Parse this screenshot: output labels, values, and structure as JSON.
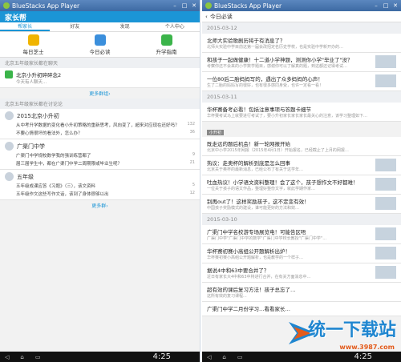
{
  "left": {
    "title": "BlueStacks App Player",
    "logo": "家长帮",
    "tabs": [
      "帮家长",
      "好友",
      "发现",
      "个人中心"
    ],
    "quick": [
      {
        "label": "每日芝士",
        "color": "#f0b400"
      },
      {
        "label": "今日必读",
        "color": "#3b8fdc"
      },
      {
        "label": "升学指南",
        "color": "#3bb44a"
      }
    ],
    "sec1": "北京五年级家长都在聊天",
    "chat_name": "北京小升初碎碎念2",
    "chat_sub": "今天有人聊天...",
    "more1": "更多群组›",
    "sec2": "北京五年级家长都在讨论论",
    "groups": [
      {
        "name": "2015北京小升初",
        "posts": [
          {
            "text": "从中考升学数据的变化看小升初策略的重新思考，风向变了，超来对应现在还好吗？",
            "count": "132"
          },
          {
            "text": "不要心情很坏的看法外，怎么办？",
            "count": "36"
          }
        ]
      },
      {
        "name": "广渠门中学",
        "posts": [
          {
            "text": "广渠门中学规校数学我的强训练营都了",
            "count": "9"
          },
          {
            "text": "届三届学生中，都在广渠门中学二周期限或毕业生呢？",
            "count": "21"
          }
        ]
      },
      {
        "name": "五年级",
        "posts": [
          {
            "text": "五年级成课应答《习题》（三），该文资料",
            "count": "5"
          },
          {
            "text": "五年级作文这些写作文话，该到了身体很够以出",
            "count": "12"
          }
        ]
      }
    ],
    "more2": "更多群›",
    "time": "4:25"
  },
  "right": {
    "title": "BlueStacks App Player",
    "header": "今日必读",
    "sections": [
      {
        "date": "2015-03-12",
        "items": [
          {
            "title": "北师大实验歌剧历将于有消息了？",
            "desc": "北师大实验中学目前这第一届会改招定名历史学校，也是实验中学新开办的…",
            "thumb": false
          },
          {
            "title": "和孩子一起做健康！十二道小学神题，测测你小学\"毕业了\"没？",
            "desc": "考察你还不会来的小学数学题目，感谢你可以了解真的题，到这都还记得考试…",
            "thumb": true
          },
          {
            "title": "一位80后二胎妈妈写的，遇出了众多妈妈的心声！",
            "desc": "生了二胎的妈妈写的很好，也有很多感同身受，也许一定看一看！",
            "thumb": true
          }
        ]
      },
      {
        "date": "2015-03-11",
        "items": [
          {
            "title": "华杯赛备考必看！包括注意事项与答题卡细节",
            "desc": "华杯赛考试马上就要进行考试了，要小升初家长家长家长最关心的注意，该学习整理如下…",
            "thumb": false
          }
        ]
      },
      {
        "tag": "小升初",
        "items": [
          {
            "title": "既走远的题后机会！新一轮网报开始",
            "desc": "北京中小学2015年网报（2015年4月1日）开始报名，已经截止了上月的网报…",
            "thumb": false
          },
          {
            "title": "热议：走奥杯的解析到底是怎么回事",
            "desc": "北京关于奥杯的最新消息，已经公布了有关于这学年…",
            "thumb": true
          },
          {
            "title": "吐血热议！小学语文资料整理！会了这个，孩子想作文不好都难！",
            "desc": "一位关于孩子的语文作品，整理好整份文字，就此学期作家…",
            "thumb": true
          },
          {
            "title": "别再out了！这样奖励孩子，这不定变有效！",
            "desc": "中国孩子奖励模式的建设，谁可能更好的方法和效…",
            "thumb": true
          }
        ]
      },
      {
        "date": "2015-03-10",
        "items": [
          {
            "title": "广渠门中学名校游专场展览电！可能告区唔",
            "desc": "广渠门中学\"广渠门中学的数学\"广渠门中学校长教授\"广渠门中学\"…",
            "thumb": true
          },
          {
            "title": "华杯赛初赛小高组公开题解析出炉！",
            "desc": "华杯赛初赛小高组公开题解析，也是教学的一个样子…",
            "thumb": true
          },
          {
            "title": "据说4中和63中要合并了？",
            "desc": "近日有家长大4中和63中将进行合并，在有关方面消息中…",
            "thumb": true
          },
          {
            "title": "超有效的课后复习方法！孩子总忘了…",
            "desc": "这所有效的复习课程...",
            "thumb": false
          },
          {
            "title": "广渠门中学二月份学习…看看家长…",
            "desc": "",
            "thumb": false
          }
        ]
      }
    ],
    "time": "4:25"
  },
  "watermark": {
    "main": "统一下载站",
    "sub": "www.3987.com"
  }
}
